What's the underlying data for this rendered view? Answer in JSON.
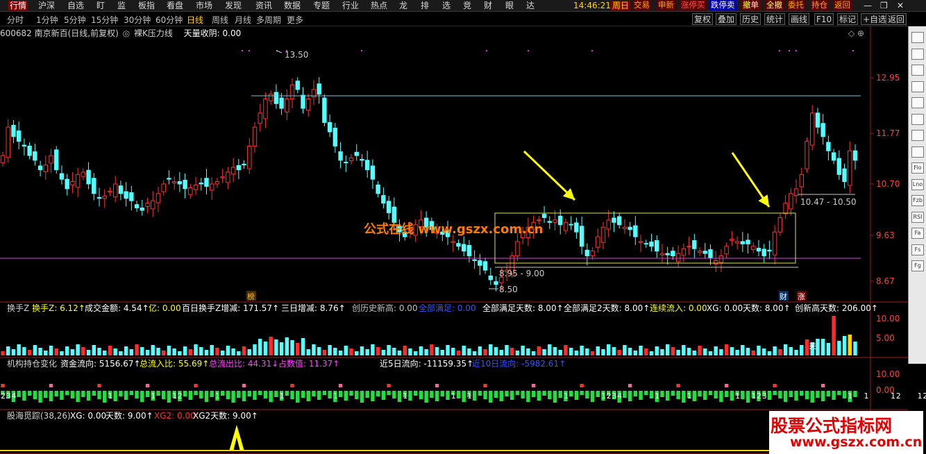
{
  "menu": [
    "行情",
    "沪深",
    "自选",
    "盯",
    "监",
    "板指",
    "看盘",
    "市场",
    "发现",
    "资讯",
    "数据",
    "专题",
    "行业",
    "热点",
    "龙",
    "排",
    "选",
    "竞",
    "财",
    "眼",
    "达"
  ],
  "clock": "14:46:21",
  "weekday": "周日",
  "top_buttons": [
    "交易",
    "申新",
    "涨停买",
    "跌停卖",
    "撤单",
    "全撤",
    "委托",
    "持仓",
    "返回"
  ],
  "periods": [
    "分时",
    "1分钟",
    "5分钟",
    "15分钟",
    "30分钟",
    "60分钟",
    "日线",
    "周线",
    "月线",
    "多周期",
    "更多"
  ],
  "active_period": "日线",
  "tools": [
    "复权",
    "叠加",
    "历史",
    "统计",
    "画线",
    "F10",
    "标记",
    "+自选",
    "返回"
  ],
  "title_bar": {
    "stock": "600682 南京新百(日线,前复权)",
    "indicator": "裸K压力线",
    "extra": "天量收阴: 0.00"
  },
  "price_labels": [
    "12.95",
    "11.77",
    "10.70",
    "9.63",
    "8.67"
  ],
  "annotations": {
    "high": "13.50",
    "low": "8.50",
    "range_low": "8.95 - 9.00",
    "range_right": "10.47 - 10.50",
    "mark_bang": "榜",
    "mark_cai": "财",
    "mark_zhang": "涨"
  },
  "watermark1": "公式在线 www.gszx.com.cn",
  "watermark2_line1": "股票公式指标网",
  "watermark2_line2": "www.gszx.com.cn",
  "panel1": {
    "items": [
      {
        "t": "换手Z",
        "c": "#d0d0d0"
      },
      {
        "t": "换手Z: 6.12↑",
        "c": "#ffff00"
      },
      {
        "t": "成交金额: 4.54↑",
        "c": "#ffffff"
      },
      {
        "t": "亿: 0.00",
        "c": "#ffff00"
      },
      {
        "t": "百日换手Z增减: 171.57↑",
        "c": "#ffffff"
      },
      {
        "t": "三日增减: 8.76↑",
        "c": "#ffffff"
      },
      {
        "t": "创历史新高: 0.00",
        "c": "#c0c0c0"
      },
      {
        "t": "全部满足: 0.00",
        "c": "#3355ff"
      },
      {
        "t": "全部满足天数: 8.00↑",
        "c": "#ffffff"
      },
      {
        "t": "全部满足2天数: 8.00↑",
        "c": "#ffffff"
      },
      {
        "t": "连续流入: 0.00",
        "c": "#ffff00"
      },
      {
        "t": "XG: 0.00",
        "c": "#ffffff"
      },
      {
        "t": "天数: 8.00↑",
        "c": "#ffffff"
      },
      {
        "t": "创新高天数: 206.00↑",
        "c": "#ffffff"
      }
    ],
    "scale": [
      "10.00",
      "5.00"
    ],
    "label_guan": "关"
  },
  "panel2": {
    "items": [
      {
        "t": "机构持仓变化",
        "c": "#d0d0d0"
      },
      {
        "t": "资金流向: 5156.67↑",
        "c": "#ffffff"
      },
      {
        "t": "总流入比: 55.69↑",
        "c": "#ffff00"
      },
      {
        "t": "总流出比: 44.31↓",
        "c": "#ff44ff"
      },
      {
        "t": "占数值: 11.37↑",
        "c": "#ff44ff"
      },
      {
        "t": "近5日流向: -11159.35↑",
        "c": "#ffffff"
      },
      {
        "t": "近10日流向: -5982.61↑",
        "c": "#3355ff"
      }
    ],
    "scale": [
      "10.00",
      "0.00"
    ],
    "digits": [
      [
        0,
        "2"
      ],
      [
        1,
        "3"
      ],
      [
        2,
        "4"
      ],
      [
        20,
        "1"
      ],
      [
        28,
        "1"
      ],
      [
        32,
        "1"
      ],
      [
        33,
        "2"
      ],
      [
        40,
        "1"
      ],
      [
        52,
        "1"
      ],
      [
        62,
        "1"
      ],
      [
        75,
        "1"
      ],
      [
        84,
        "1"
      ],
      [
        87,
        "1"
      ],
      [
        105,
        "1"
      ],
      [
        112,
        "1"
      ],
      [
        113,
        "2"
      ],
      [
        114,
        "3"
      ],
      [
        115,
        "4"
      ],
      [
        122,
        "1"
      ],
      [
        128,
        "1"
      ],
      [
        137,
        "1"
      ],
      [
        140,
        "1"
      ],
      [
        141,
        "2"
      ],
      [
        142,
        "3"
      ],
      [
        158,
        "1"
      ],
      [
        161,
        "1"
      ],
      [
        166,
        "1"
      ],
      [
        167,
        "2"
      ],
      [
        171,
        "1"
      ],
      [
        172,
        "2"
      ],
      [
        173,
        "3"
      ],
      [
        186,
        "1"
      ]
    ]
  },
  "panel3": {
    "items": [
      {
        "t": "股海觅踪(38,26)",
        "c": "#d0d0d0"
      },
      {
        "t": "XG: 0.00",
        "c": "#ffffff"
      },
      {
        "t": "天数: 9.00↑",
        "c": "#ffffff"
      },
      {
        "t": "XG2: 0.00",
        "c": "#ff3333"
      },
      {
        "t": "XG2天数: 9.00↑",
        "c": "#ffffff"
      }
    ]
  },
  "side_icons": [
    "scroll-up",
    "chart-a",
    "chart-b",
    "chart-c",
    "chart-d",
    "chart-e",
    "chart-f",
    "chart-g",
    "Fio",
    "Lno",
    "Fzb",
    "RSI",
    "Fa",
    "Fs",
    "Fg"
  ],
  "colors": {
    "up": "#ff3232",
    "down": "#54ffff",
    "yellow": "#ffff00",
    "magenta": "#ff00ff",
    "line": "#70c8d8"
  }
}
